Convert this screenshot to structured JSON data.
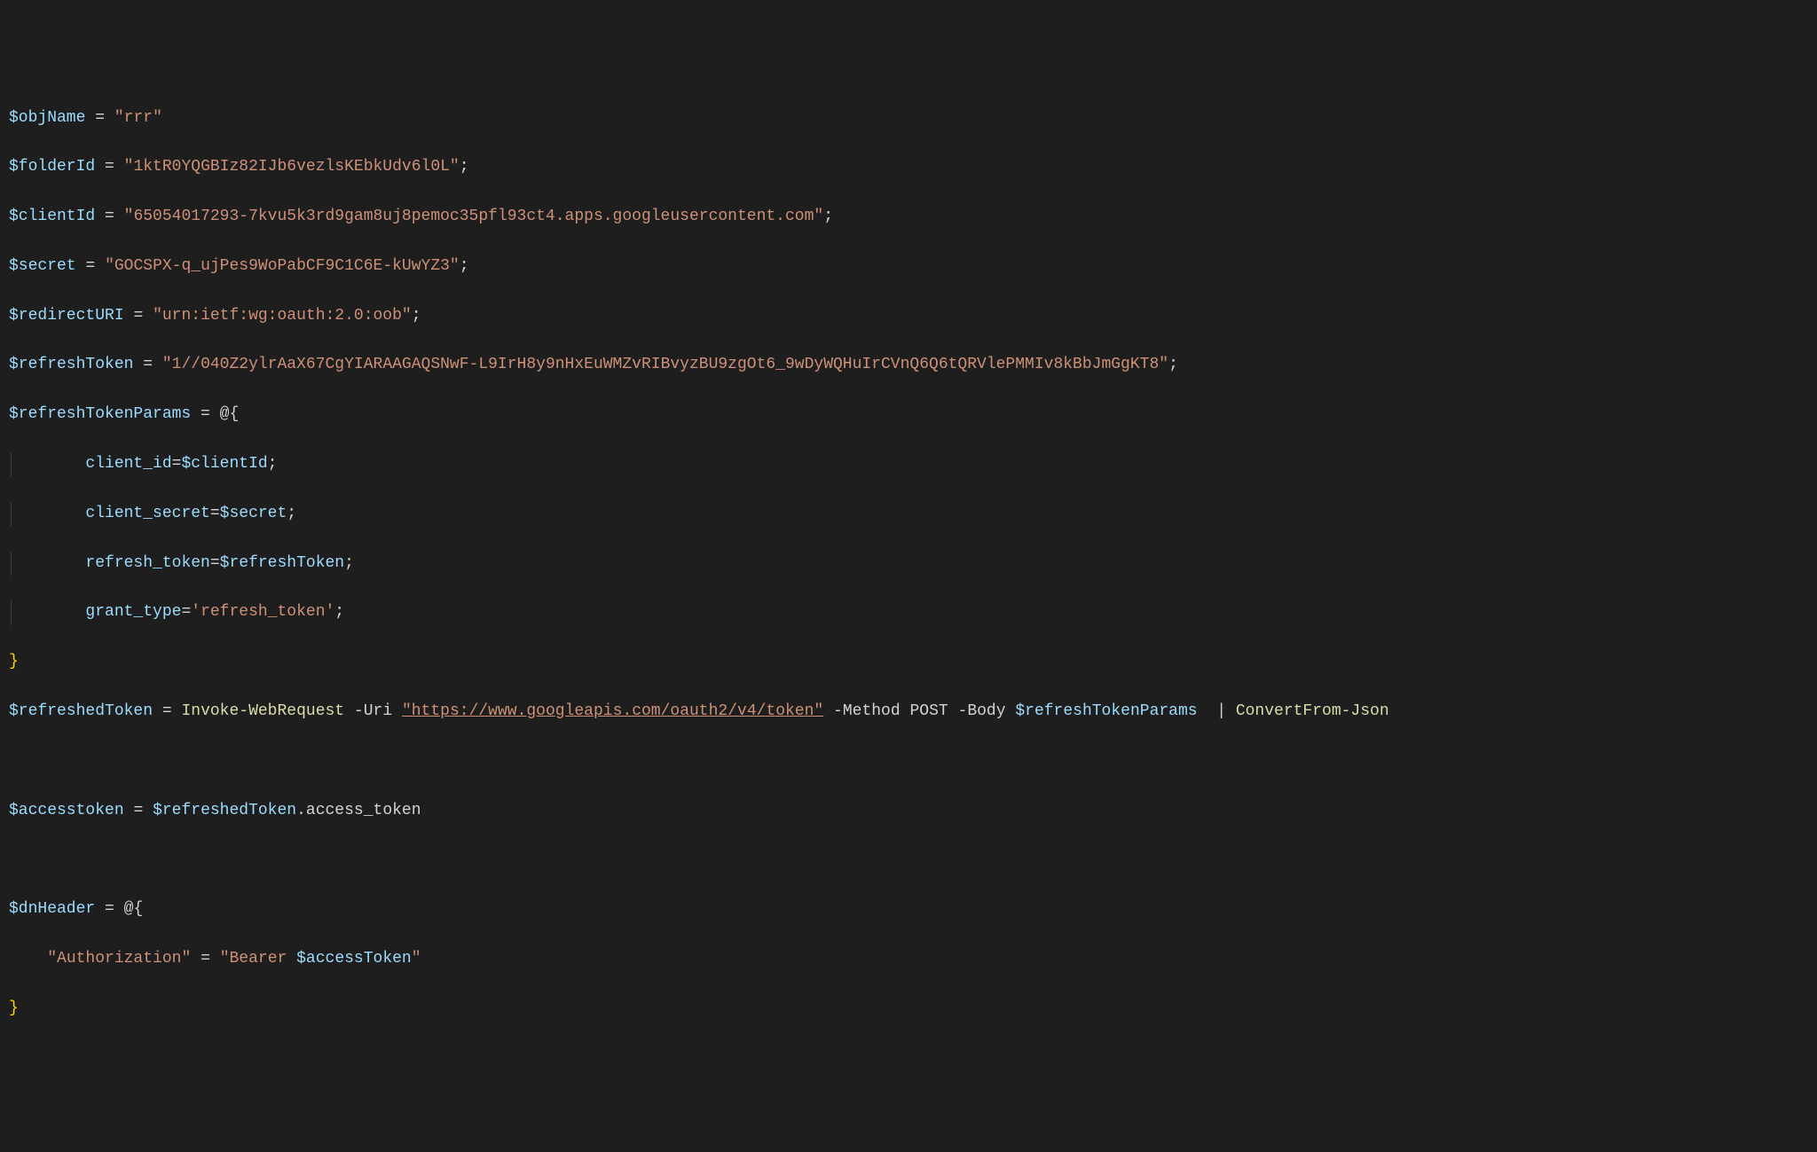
{
  "vars": {
    "objName": "$objName",
    "folderId": "$folderId",
    "clientId": "$clientId",
    "secret": "$secret",
    "redirectURI": "$redirectURI",
    "refreshToken": "$refreshToken",
    "refreshTokenParams": "$refreshTokenParams",
    "refreshedToken": "$refreshedToken",
    "accesstoken": "$accesstoken",
    "dnHeader": "$dnHeader",
    "accessTokenUpper": "$accessToken"
  },
  "values": {
    "objName": "\"rrr\"",
    "folderId": "\"1ktR0YQGBIz82IJb6vezlsKEbkUdv6l0L\"",
    "clientId": "\"65054017293-7kvu5k3rd9gam8uj8pemoc35pfl93ct4.apps.googleusercontent.com\"",
    "secret": "\"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\"",
    "redirectURI": "\"urn:ietf:wg:oauth:2.0:oob\"",
    "refreshToken": "\"1//040Z2ylrAaX67CgYIARAAGAQSNwF-L9IrH8y9nHxEuWMZvRIBvyzBU9zgOt6_9wDyWQHuIrCVnQ6Q6tQRVlePMMIv8kBbJmGgKT8\"",
    "refreshTokenLiteral": "'refresh_token'",
    "uri": "\"https://www.googleapis.com/oauth2/v4/token\"",
    "authKey": "\"Authorization\"",
    "bearerPrefix": "\"Bearer ",
    "bearerEnd": "\""
  },
  "ops": {
    "eq": "=",
    "semi": ";",
    "atOpen": "@{",
    "close": "}",
    "pipe": "|",
    "dot": "."
  },
  "hash": {
    "clientIdKey": "client_id",
    "clientSecretKey": "client_secret",
    "refreshTokenKey": "refresh_token",
    "grantTypeKey": "grant_type"
  },
  "cmd": {
    "invoke": "Invoke-WebRequest",
    "convert": "ConvertFrom-Json"
  },
  "params": {
    "uri": "-Uri",
    "method": "-Method",
    "body": "-Body",
    "post": "POST"
  },
  "members": {
    "accessToken": "access_token"
  },
  "indent": "        "
}
